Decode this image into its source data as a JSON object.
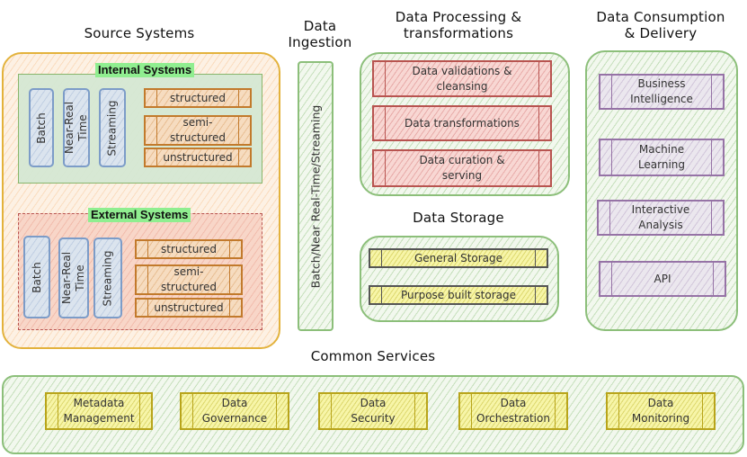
{
  "headings": {
    "source_systems": "Source Systems",
    "data_ingestion": "Data\nIngestion",
    "data_ingestion_line1": "Data",
    "data_ingestion_line2": "Ingestion",
    "data_processing_line1": "Data Processing &",
    "data_processing_line2": "transformations",
    "data_consumption_line1": "Data Consumption",
    "data_consumption_line2": "& Delivery",
    "data_storage": "Data Storage",
    "common_services": "Common Services"
  },
  "source_systems": {
    "internal": {
      "title": "Internal Systems",
      "modes": [
        {
          "line1": "Batch",
          "line2": ""
        },
        {
          "line1": "Near-Real",
          "line2": "Time"
        },
        {
          "line1": "Streaming",
          "line2": ""
        }
      ],
      "types": [
        "structured",
        "semi-structured",
        "unstructured"
      ],
      "types_display": [
        {
          "line1": "structured",
          "line2": ""
        },
        {
          "line1": "semi-",
          "line2": "structured"
        },
        {
          "line1": "unstructured",
          "line2": ""
        }
      ]
    },
    "external": {
      "title": "External Systems",
      "modes": [
        {
          "line1": "Batch",
          "line2": ""
        },
        {
          "line1": "Near-Real",
          "line2": "Time"
        },
        {
          "line1": "Streaming",
          "line2": ""
        }
      ],
      "types_display": [
        {
          "line1": "structured",
          "line2": ""
        },
        {
          "line1": "semi-",
          "line2": "structured"
        },
        {
          "line1": "unstructured",
          "line2": ""
        }
      ]
    }
  },
  "ingestion": {
    "label": "Batch/Near Real-Time/Streaming"
  },
  "processing": {
    "steps": [
      {
        "line1": "Data validations &",
        "line2": "cleansing"
      },
      {
        "line1": "Data transformations",
        "line2": ""
      },
      {
        "line1": "Data curation &",
        "line2": "serving"
      }
    ]
  },
  "storage": {
    "items": [
      "General Storage",
      "Purpose built storage"
    ]
  },
  "consumption": {
    "items": [
      {
        "line1": "Business",
        "line2": "Intelligence"
      },
      {
        "line1": "Machine",
        "line2": "Learning"
      },
      {
        "line1": "Interactive",
        "line2": "Analysis"
      },
      {
        "line1": "API",
        "line2": ""
      }
    ]
  },
  "common_services": {
    "items": [
      {
        "line1": "Metadata",
        "line2": "Management"
      },
      {
        "line1": "Data",
        "line2": "Governance"
      },
      {
        "line1": "Data",
        "line2": "Security"
      },
      {
        "line1": "Data",
        "line2": "Orchestration"
      },
      {
        "line1": "Data",
        "line2": "Monitoring"
      }
    ]
  },
  "colors": {
    "source_container": "#e3b23c",
    "green_container": "#8cbf7a",
    "internal_fill": "#d5e8d4",
    "external_fill": "#f8cecc",
    "title_highlight": "#90ee90",
    "processing": "#b85450",
    "storage": "#b8a41a",
    "consumption": "#9673a6",
    "data_types": "#c27a2c",
    "modes": "#7c9cc8"
  }
}
